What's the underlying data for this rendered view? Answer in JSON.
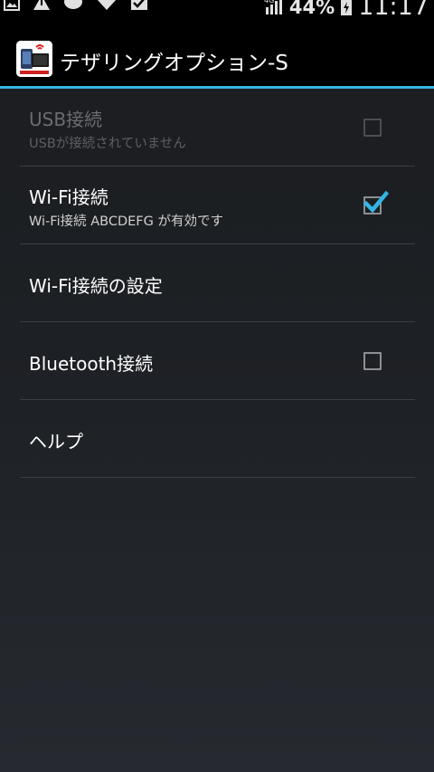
{
  "status_bar": {
    "battery_percent": "44%",
    "time": "11:17",
    "network": "4G",
    "left_icons": [
      "gallery-icon",
      "alert-icon",
      "chat-icon",
      "wifi-icon",
      "check-icon"
    ]
  },
  "action_bar": {
    "title": "テザリングオプション-S",
    "icon": "tethering-app-icon",
    "accent_color": "#33b5e5"
  },
  "settings": {
    "items": [
      {
        "title": "USB接続",
        "subtitle": "USBが接続されていません",
        "checked": false,
        "enabled": false
      },
      {
        "title": "Wi-Fi接続",
        "subtitle": "Wi-Fi接続 ABCDEFG が有効です",
        "checked": true,
        "enabled": true
      },
      {
        "title": "Wi-Fi接続の設定"
      },
      {
        "title": "Bluetooth接続",
        "checked": false,
        "enabled": true
      },
      {
        "title": "ヘルプ"
      }
    ]
  }
}
